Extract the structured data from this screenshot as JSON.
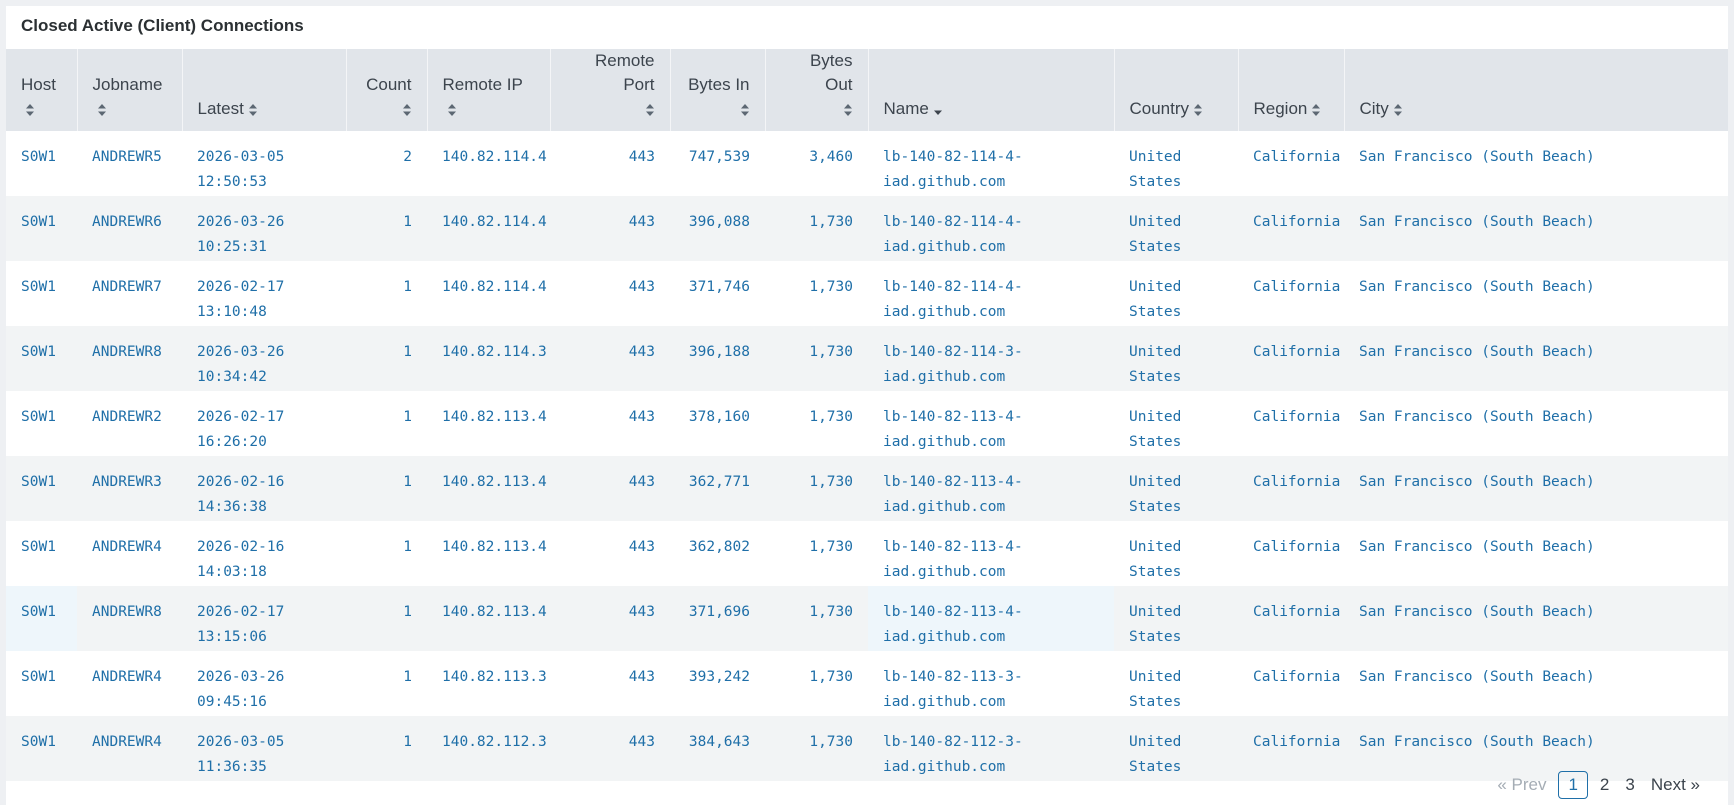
{
  "panel": {
    "title": "Closed Active (Client) Connections"
  },
  "columns": [
    {
      "key": "host",
      "label": "Host"
    },
    {
      "key": "jobname",
      "label": "Jobname"
    },
    {
      "key": "latest",
      "label": "Latest"
    },
    {
      "key": "count",
      "label": "Count"
    },
    {
      "key": "remote_ip",
      "label": "Remote IP"
    },
    {
      "key": "remote_port",
      "label": "Remote Port"
    },
    {
      "key": "bytes_in",
      "label": "Bytes In"
    },
    {
      "key": "bytes_out",
      "label": "Bytes Out"
    },
    {
      "key": "name",
      "label": "Name",
      "sorted": "desc"
    },
    {
      "key": "country",
      "label": "Country"
    },
    {
      "key": "region",
      "label": "Region"
    },
    {
      "key": "city",
      "label": "City"
    }
  ],
  "rows": [
    {
      "host": "S0W1",
      "jobname": "ANDREWR5",
      "latest": "2026-03-05 12:50:53",
      "count": "2",
      "remote_ip": "140.82.114.4",
      "remote_port": "443",
      "bytes_in": "747,539",
      "bytes_out": "3,460",
      "name": "lb-140-82-114-4-iad.github.com",
      "country": "United States",
      "region": "California",
      "city": "San Francisco (South Beach)"
    },
    {
      "host": "S0W1",
      "jobname": "ANDREWR6",
      "latest": "2026-03-26 10:25:31",
      "count": "1",
      "remote_ip": "140.82.114.4",
      "remote_port": "443",
      "bytes_in": "396,088",
      "bytes_out": "1,730",
      "name": "lb-140-82-114-4-iad.github.com",
      "country": "United States",
      "region": "California",
      "city": "San Francisco (South Beach)"
    },
    {
      "host": "S0W1",
      "jobname": "ANDREWR7",
      "latest": "2026-02-17 13:10:48",
      "count": "1",
      "remote_ip": "140.82.114.4",
      "remote_port": "443",
      "bytes_in": "371,746",
      "bytes_out": "1,730",
      "name": "lb-140-82-114-4-iad.github.com",
      "country": "United States",
      "region": "California",
      "city": "San Francisco (South Beach)"
    },
    {
      "host": "S0W1",
      "jobname": "ANDREWR8",
      "latest": "2026-03-26 10:34:42",
      "count": "1",
      "remote_ip": "140.82.114.3",
      "remote_port": "443",
      "bytes_in": "396,188",
      "bytes_out": "1,730",
      "name": "lb-140-82-114-3-iad.github.com",
      "country": "United States",
      "region": "California",
      "city": "San Francisco (South Beach)"
    },
    {
      "host": "S0W1",
      "jobname": "ANDREWR2",
      "latest": "2026-02-17 16:26:20",
      "count": "1",
      "remote_ip": "140.82.113.4",
      "remote_port": "443",
      "bytes_in": "378,160",
      "bytes_out": "1,730",
      "name": "lb-140-82-113-4-iad.github.com",
      "country": "United States",
      "region": "California",
      "city": "San Francisco (South Beach)"
    },
    {
      "host": "S0W1",
      "jobname": "ANDREWR3",
      "latest": "2026-02-16 14:36:38",
      "count": "1",
      "remote_ip": "140.82.113.4",
      "remote_port": "443",
      "bytes_in": "362,771",
      "bytes_out": "1,730",
      "name": "lb-140-82-113-4-iad.github.com",
      "country": "United States",
      "region": "California",
      "city": "San Francisco (South Beach)"
    },
    {
      "host": "S0W1",
      "jobname": "ANDREWR4",
      "latest": "2026-02-16 14:03:18",
      "count": "1",
      "remote_ip": "140.82.113.4",
      "remote_port": "443",
      "bytes_in": "362,802",
      "bytes_out": "1,730",
      "name": "lb-140-82-113-4-iad.github.com",
      "country": "United States",
      "region": "California",
      "city": "San Francisco (South Beach)"
    },
    {
      "host": "S0W1",
      "jobname": "ANDREWR8",
      "latest": "2026-02-17 13:15:06",
      "count": "1",
      "remote_ip": "140.82.113.4",
      "remote_port": "443",
      "bytes_in": "371,696",
      "bytes_out": "1,730",
      "name": "lb-140-82-113-4-iad.github.com",
      "country": "United States",
      "region": "California",
      "city": "San Francisco (South Beach)"
    },
    {
      "host": "S0W1",
      "jobname": "ANDREWR4",
      "latest": "2026-03-26 09:45:16",
      "count": "1",
      "remote_ip": "140.82.113.3",
      "remote_port": "443",
      "bytes_in": "393,242",
      "bytes_out": "1,730",
      "name": "lb-140-82-113-3-iad.github.com",
      "country": "United States",
      "region": "California",
      "city": "San Francisco (South Beach)"
    },
    {
      "host": "S0W1",
      "jobname": "ANDREWR4",
      "latest": "2026-03-05 11:36:35",
      "count": "1",
      "remote_ip": "140.82.112.3",
      "remote_port": "443",
      "bytes_in": "384,643",
      "bytes_out": "1,730",
      "name": "lb-140-82-112-3-iad.github.com",
      "country": "United States",
      "region": "California",
      "city": "San Francisco (South Beach)"
    }
  ],
  "pagination": {
    "prev": "« Prev",
    "pages": [
      "1",
      "2",
      "3"
    ],
    "current": "1",
    "next": "Next »"
  },
  "colors": {
    "link": "#1f6fa8",
    "header_bg": "#e1e5ea",
    "row_alt": "#f2f4f5",
    "highlight": "#eef6fb"
  }
}
